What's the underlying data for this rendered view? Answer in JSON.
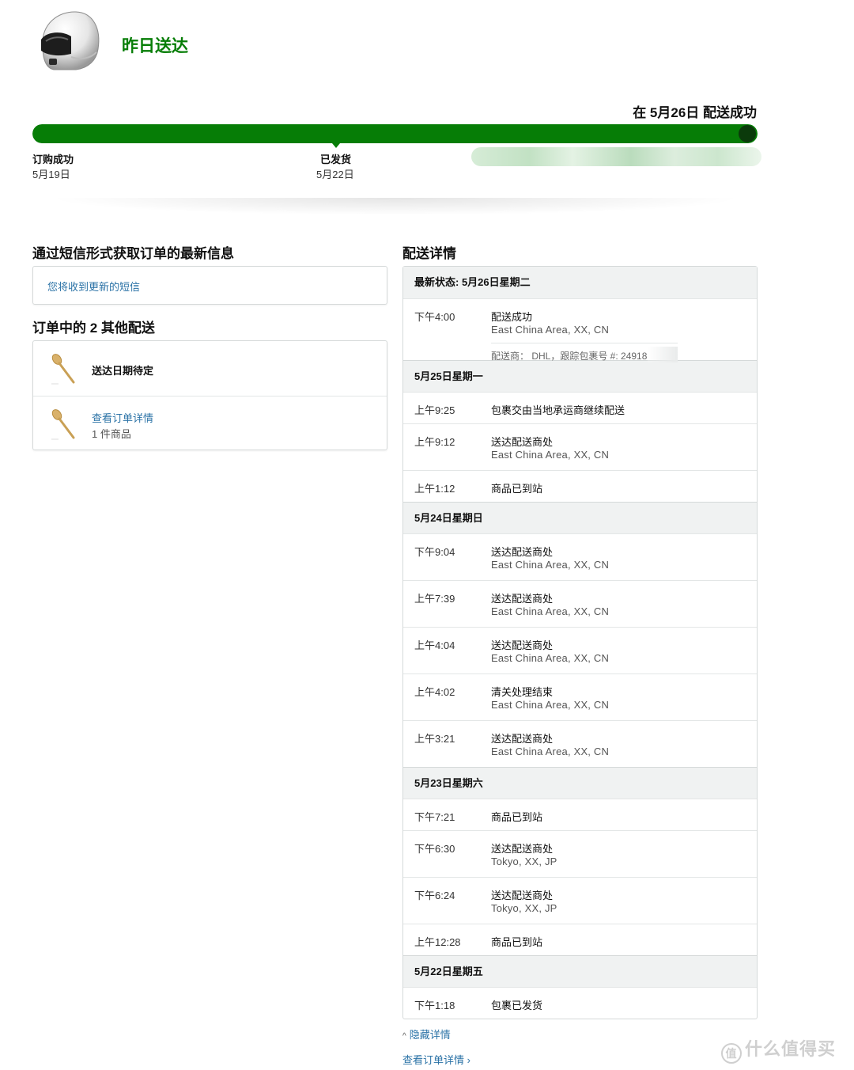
{
  "header": {
    "headline": "昨日送达",
    "delivered_on": "在 5月26日 配送成功",
    "product_image": "helmet-image"
  },
  "progress": {
    "fraction": 1.0,
    "color": "#067d06",
    "milestones": [
      {
        "label": "订购成功",
        "date": "5月19日"
      },
      {
        "label": "已发货",
        "date": "5月22日"
      }
    ]
  },
  "sms": {
    "title": "通过短信形式获取订单的最新信息",
    "text": "您将收到更新的短信"
  },
  "other": {
    "title": "订单中的 2 其他配送",
    "items": [
      {
        "title": "送达日期待定"
      },
      {
        "link": "查看订单详情",
        "sub": "1 件商品"
      }
    ]
  },
  "tracking": {
    "title": "配送详情",
    "latest": "最新状态: 5月26日星期二",
    "first": {
      "time": "下午4:00",
      "status": "配送成功",
      "loc": "East China Area, XX, CN",
      "carrier": "配送商： DHL，跟踪包裹号 #: 24918"
    },
    "day25": "5月25日星期一",
    "e25": [
      {
        "time": "上午9:25",
        "status": "包裹交由当地承运商继续配送"
      },
      {
        "time": "上午9:12",
        "status": "送达配送商处",
        "loc": "East China Area, XX, CN"
      },
      {
        "time": "上午1:12",
        "status": "商品已到站"
      }
    ],
    "day24": "5月24日星期日",
    "e24": [
      {
        "time": "下午9:04",
        "status": "送达配送商处",
        "loc": "East China Area, XX, CN"
      },
      {
        "time": "上午7:39",
        "status": "送达配送商处",
        "loc": "East China Area, XX, CN"
      },
      {
        "time": "上午4:04",
        "status": "送达配送商处",
        "loc": "East China Area, XX, CN"
      },
      {
        "time": "上午4:02",
        "status": "清关处理结束",
        "loc": "East China Area, XX, CN"
      },
      {
        "time": "上午3:21",
        "status": "送达配送商处",
        "loc": "East China Area, XX, CN"
      }
    ],
    "day23": "5月23日星期六",
    "e23": [
      {
        "time": "下午7:21",
        "status": "商品已到站"
      },
      {
        "time": "下午6:30",
        "status": "送达配送商处",
        "loc": "Tokyo, XX, JP"
      },
      {
        "time": "下午6:24",
        "status": "送达配送商处",
        "loc": "Tokyo, XX, JP"
      },
      {
        "time": "上午12:28",
        "status": "商品已到站"
      }
    ],
    "day22": "5月22日星期五",
    "e22": [
      {
        "time": "下午1:18",
        "status": "包裹已发货"
      }
    ]
  },
  "links": {
    "hide": "隐藏详情",
    "view_order": "查看订单详情 ›"
  },
  "watermark": "什么值得买",
  "watermark_icon": "值"
}
